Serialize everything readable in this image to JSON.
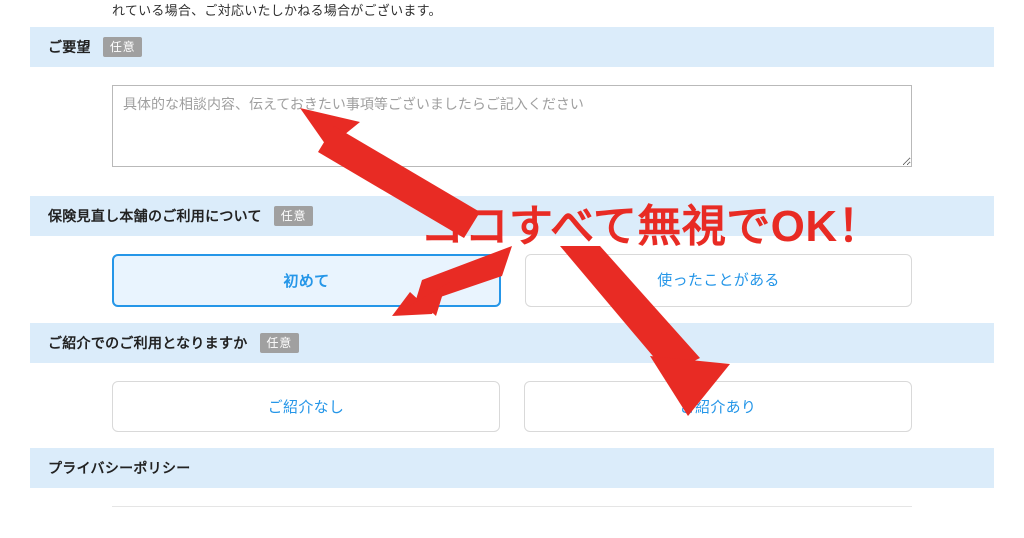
{
  "cutoff_line": "れている場合、ご対応いたしかねる場合がございます。",
  "sections": {
    "requests": {
      "title": "ご要望",
      "badge": "任意",
      "textarea_placeholder": "具体的な相談内容、伝えておきたい事項等ございましたらご記入ください"
    },
    "usage": {
      "title": "保険見直し本舗のご利用について",
      "badge": "任意",
      "options": {
        "first": {
          "label": "初めて",
          "selected": true
        },
        "before": {
          "label": "使ったことがある",
          "selected": false
        }
      }
    },
    "referral": {
      "title": "ご紹介でのご利用となりますか",
      "badge": "任意",
      "options": {
        "no": {
          "label": "ご紹介なし",
          "selected": false
        },
        "yes": {
          "label": "ご紹介あり",
          "selected": false
        }
      }
    },
    "privacy": {
      "title": "プライバシーポリシー"
    }
  },
  "annotation": {
    "text": "ココすべて無視でOK！",
    "color": "#e82b24"
  }
}
